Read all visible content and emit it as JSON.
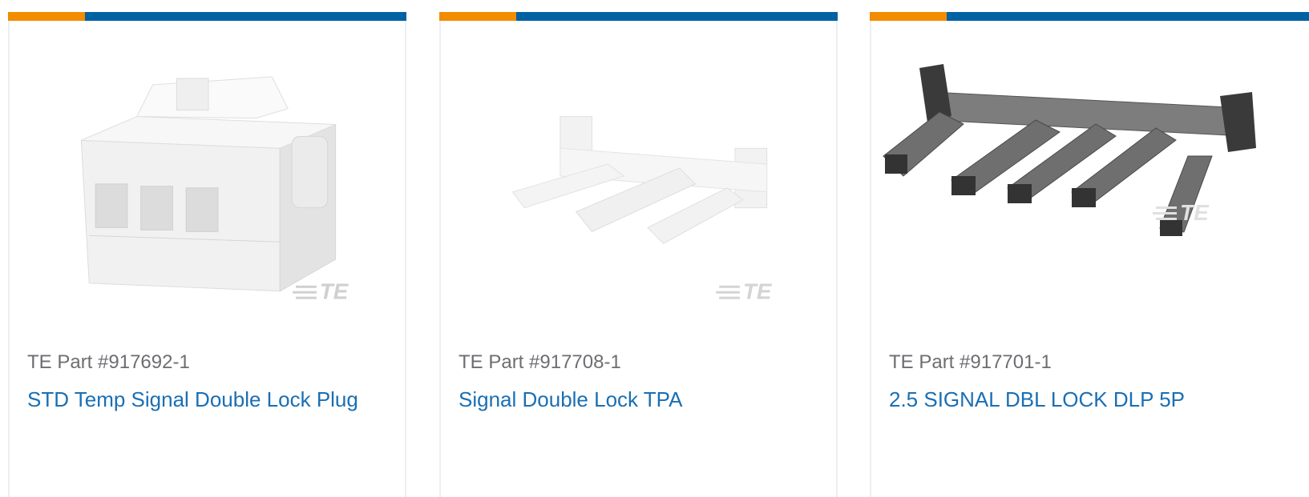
{
  "colors": {
    "accent_orange": "#f28c00",
    "accent_blue": "#0062a3",
    "part_text": "#6d6e71",
    "link_text": "#1a6fb3",
    "card_border": "#eceff2"
  },
  "cards": [
    {
      "part_number": "TE Part #917692-1",
      "name": "STD Temp Signal Double Lock Plug",
      "image_icon": "white-connector-plug-image",
      "watermark": "TE"
    },
    {
      "part_number": "TE Part #917708-1",
      "name": "Signal Double Lock TPA",
      "image_icon": "white-tpa-lock-image",
      "watermark": "TE"
    },
    {
      "part_number": "TE Part #917701-1",
      "name": "2.5 SIGNAL DBL LOCK DLP 5P",
      "image_icon": "gray-dlp-lock-image",
      "watermark": "TE"
    }
  ]
}
